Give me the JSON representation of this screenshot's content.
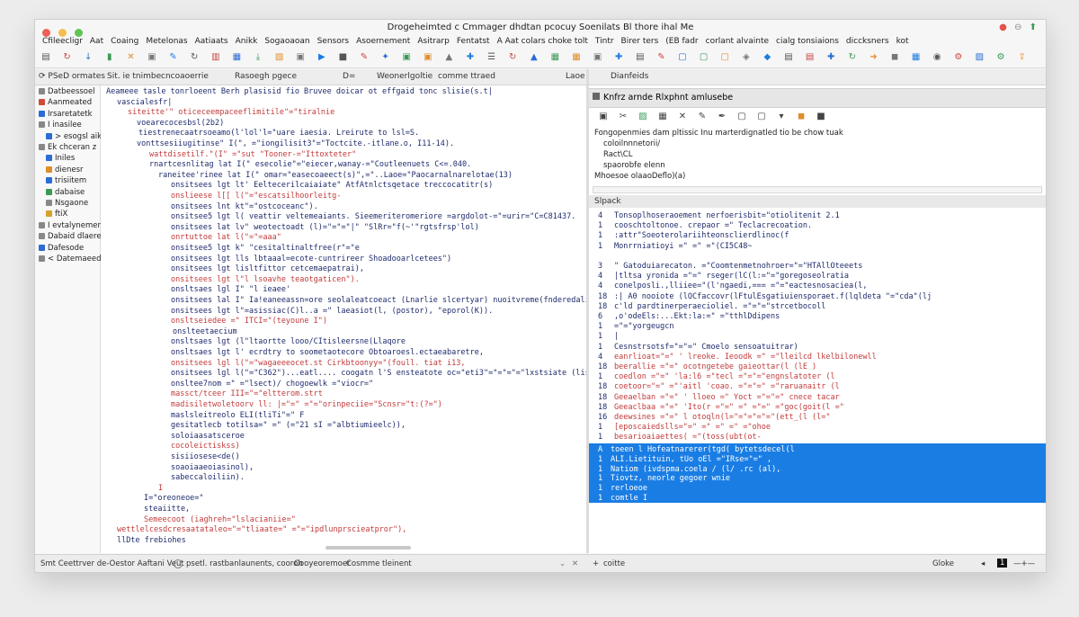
{
  "window": {
    "title": "Drogeheimted c Cmmager dhdtan pcocuy Soenilats Bl thore ihal Me",
    "controls_right": [
      "●",
      "⊖",
      "⬆"
    ]
  },
  "colors": {
    "close": "#ee5f57",
    "minimize": "#f5bd4f",
    "maximize": "#5fc453",
    "accent_blue": "#1a7de4",
    "string_red": "#c23a3a",
    "code_navy": "#1f2b6c"
  },
  "menu": [
    "Cfileecligr",
    "Aat",
    "Coaing",
    "Metelonas",
    "Aatiaats",
    "Anikk",
    "Sogaoaoan",
    "Sensors",
    "Asoernement",
    "Asitrarp",
    "Fentatst",
    "A Aat colars choke tolt",
    "Tintr",
    "Birer ters",
    "(EB fadr",
    "corlant alvainte",
    "cialg tonsiaions",
    "diccksners",
    "kot"
  ],
  "toolbar_icons": [
    "document-icon",
    "refresh-icon",
    "down-arrow-icon",
    "bookmark-icon",
    "close-x-icon",
    "window-icon",
    "paint-icon",
    "refresh-icon",
    "panel-icon",
    "grid-icon",
    "download-icon",
    "layout-icon",
    "window-icon",
    "play-icon",
    "square-icon",
    "edit-icon",
    "star-icon",
    "window-icon",
    "window-icon",
    "lock-icon",
    "pin-icon",
    "list-icon",
    "refresh-icon",
    "lock-icon",
    "grid-icon",
    "grid-icon",
    "window-icon",
    "pin-icon",
    "document-icon",
    "edit-icon",
    "frame-icon",
    "frame-icon",
    "frame-icon",
    "palette-icon",
    "shapes-icon",
    "doc-icon",
    "doc-icon",
    "pin-icon",
    "refresh-icon",
    "arrow-icon",
    "stop-icon",
    "grid-icon",
    "shield-icon",
    "gear-icon",
    "chart-icon",
    "settings-icon",
    "share-icon"
  ],
  "tabs": {
    "left": [
      "⟳ PSeD ormates",
      "Sit. ie tnimbe",
      "cncoaoerrie",
      "Rasoegh pgece",
      "D=",
      "Weonerlgoltie",
      "comme ttraed",
      "Laoe"
    ],
    "right": "Dianfeids"
  },
  "sidebar": [
    {
      "label": "Datbeessoel",
      "color": "#888888"
    },
    {
      "label": "Aanmeated",
      "color": "#d04a3b"
    },
    {
      "label": "Irsaretatetk",
      "color": "#2b6dd4"
    },
    {
      "label": "I inasilee",
      "color": "#888888"
    },
    {
      "label": "> esogsl aik",
      "color": "#2b6dd4"
    },
    {
      "label": "Ek chceran z",
      "color": "#888888"
    },
    {
      "label": "Iniles",
      "color": "#2b6dd4"
    },
    {
      "label": "dienesr",
      "color": "#e08d2c"
    },
    {
      "label": "trisiitem",
      "color": "#2b6dd4"
    },
    {
      "label": "dabaise",
      "color": "#3a9a55"
    },
    {
      "label": "Nsgaone",
      "color": "#888888"
    },
    {
      "label": "ftiX",
      "color": "#d6a32a"
    },
    {
      "label": "I evtalynements",
      "color": "#888888"
    },
    {
      "label": "Dabaid dlaere",
      "color": "#888888"
    },
    {
      "label": "Dafesode",
      "color": "#2b6dd4"
    },
    {
      "label": "< Datemaeed",
      "color": "#888888"
    }
  ],
  "editor": {
    "lines": [
      {
        "n": "",
        "t": "Aeameee tasle tonrloeent Berh plasisid fio Bruvee doicar ot effgaid tonc slisie(s.t|"
      },
      {
        "n": "",
        "t": "vascialesfr|"
      },
      {
        "n": "",
        "t": "siteitte'\" oticeceempaceeflimitile\"=\"tiralnie"
      },
      {
        "n": "",
        "t": "voearecocesbsl(2b2)"
      },
      {
        "n": "",
        "t": "tiestrenecaatrsoeamo(l'lol'l=\"uare iaesia. Lreirute to lsl=S."
      },
      {
        "n": "",
        "t": "vonttsesiiugitinse\"  I(\", =\"iongilisit3\"=\"Toctcite.-itlane.o,  I11-14)."
      },
      {
        "n": "",
        "t": "wattdisetilf.\"(I\" =\"sut \"Tooner-=\"Ittoxteter\""
      },
      {
        "n": "",
        "t": "rnartcesnlitag  lat  I(\" esecolie\"=\"eiecer,wanay-=\"Coutleenuets  C<=.040."
      },
      {
        "n": "",
        "t": "raneitee'rinee  lat  I(\" omar=\"easecoaeect(s)\",=\"..Laoe=\"Paocarnalnarelotae(13)"
      },
      {
        "n": "",
        "t": "onsitsees  lgt  lt' Eeltecerilcaiaiate\"   AtfAtnlctsqetace treccocatitr(s)"
      },
      {
        "n": "",
        "t": "onslieese  l[[  l(\"=\"escatsilhoorleitg-"
      },
      {
        "n": "",
        "t": "onsitsees  lnt  kt\"=\"ostcoceanc\")."
      },
      {
        "n": "",
        "t": "onsitsee5  lgt  l(  veattir  veltemeaiants.  Sieemeriteromeriore  =argdolot-=\"=urir=\"C=C81437."
      },
      {
        "n": "",
        "t": "onsitsees  lat  lv\"  weotectoadt (l)=\"=\"=\"|\" \"SlRr=\"f(~'\"rgtsfrsp'lol)"
      },
      {
        "n": "",
        "t": "onrtuttoe  lat  l(\"=\"=aaa\""
      },
      {
        "n": "",
        "t": "onsitsee5  lgt  k\"  \"cesitaltinaltfree(r\"=\"e"
      },
      {
        "n": "",
        "t": "onsitsees  lgt  lls  lbtaaal=ecote-cuntrireer  Shoadooarlcetees\")"
      },
      {
        "n": "",
        "t": "onsitsees  lgt  lisltfittor   cetcemaepatrai),"
      },
      {
        "n": "",
        "t": "onsitsees  lgt  l\"l  lsoavhe teaotgaticen\")."
      },
      {
        "n": "",
        "t": "onsltsaes  lgl  I\"  \"l ieaee'"
      },
      {
        "n": "",
        "t": "onsitsees  lal  I\"  Ia!eaneeassn=ore  seolaleatcoeact  (Lnarlie  slcertyar)  nuoitvreme(fnderedali,"
      },
      {
        "n": "",
        "t": "onsitsees  lgt  l\"=asissiac(C)l..a  =\"  laeasiot(l,  (postor),  \"eporol(K))."
      },
      {
        "n": "",
        "t": "onsltseiedee  =\"  ITCI=\"(teyoune  I\")"
      },
      {
        "n": "",
        "t": "onslteetaecium"
      },
      {
        "n": "",
        "t": "onsltsaes  lgt  (l\"ltaortte  looo/CItisleersne(Llaqore"
      },
      {
        "n": "",
        "t": "onsltsaes  lgt  l'  ecrdtry  to  soometaotecore  Obtoaroesl.ectaeabaretre,"
      },
      {
        "n": "",
        "t": "onsitsees  lgl  l(\"=\"wagaeeeocet.st  Cirkbtoonyy=\"(foull.  tiat  i13,"
      },
      {
        "n": "",
        "t": "onsitsees  lgl  l(\"=\"C362\")...eatl....  coogatn  l'S  ensteatote  oc=\"eti3\"=\"=\"=\"=\"lxstsiate  (lisocoete  (j"
      },
      {
        "n": "",
        "t": "onsltee7nom  =\"  =\"lsect)/  chogoewlk  =\"viocr=\""
      },
      {
        "n": "",
        "t": "massct/tceer  III=\"=\"eltterom.strt"
      },
      {
        "n": "",
        "t": "madisiletwoletoorv   ll:  |=\"=\"  =\"=\"orinpeciie=\"Scnsr=\"t:(?=\")"
      },
      {
        "n": "",
        "t": "maslsleitreolo  ELI(tliTi\"=\"  F"
      },
      {
        "n": "",
        "t": "gesitatlecb  totilsa=\"  =\"  (=\"21  sI  =\"albtiumieelc)),"
      },
      {
        "n": "",
        "t": "soloiaasatsceroe"
      },
      {
        "n": "",
        "t": "cocoleictiskss)"
      },
      {
        "n": "",
        "t": "sisiiosese<de()"
      },
      {
        "n": "",
        "t": "soaoiaaeoiasinol),"
      },
      {
        "n": "",
        "t": "sabeccaloiliin)."
      },
      {
        "n": "",
        "t": "I"
      },
      {
        "n": "I",
        "t": "=\"oreoneoe=\""
      },
      {
        "n": "",
        "t": "steaiitte,"
      },
      {
        "n": "",
        "t": "Semeecoot  (iaghreh=\"lslacianiie=\""
      },
      {
        "n": "",
        "t": "wettlelcesdcresaatataleo=\"=\"tliaate=\"  =\"=\"ipdlunprscieatpror\"),"
      },
      {
        "n": "",
        "t": "llDte      frebiohes"
      }
    ]
  },
  "right_panel": {
    "header": "Knfrz arnde Rlxphnt amlusebe",
    "toolbar_icons": [
      "save-icon",
      "cut-icon",
      "chart-icon",
      "grid-icon",
      "close-x-icon",
      "brush-icon",
      "pen-icon",
      "frame-icon",
      "frame-icon",
      "dropdown-icon",
      "stop-icon",
      "square-icon"
    ],
    "messages": [
      "Fongopenmies dam pltissic Inu marterdignatled tio be chow tuak",
      "coloilnnnetorii/",
      "Ract\\CL",
      "spaorobfe elenn",
      "Mhoesoe olaaoDeflo)(a)"
    ],
    "section_label": "Slpack",
    "output_lines": [
      {
        "n": "4",
        "t": "Tonsoplhoseraoement  nerfoerisbit=\"otiolitenit  2.1"
      },
      {
        "n": "1",
        "t": "cooschtoltonoe.  crepaor  =\"  Teclacrecoation."
      },
      {
        "n": "1",
        "t": "  :attr\"Soeoterolariihteonsclierdlinoc(f"
      },
      {
        "n": "1",
        "t": "    Monrrniatioyi  =\"  =\"  =\"(CI5C48~"
      },
      {
        "n": "",
        "t": ""
      },
      {
        "n": "3",
        "t": "    \"   Gatoduiarecaton.  =\"Coomtenmetnohroer=\"=\"HTAllOteeets"
      },
      {
        "n": "4",
        "t": "    |tltsa  yronida  =\"=\"  rseger(lC(l:=\"=\"goregoseolratia"
      },
      {
        "n": "4",
        "t": "       conelposli.,lliiee=\"(l'ngaedi,===  =\"=\"eactesnosaciea(l,"
      },
      {
        "n": "18",
        "t": "         :|  A0  nooiote  (lOCfaccovr(lFtulEsgatiuiensporaet.f(lqldeta  \"=\"cda\"(lj"
      },
      {
        "n": "18",
        "t": "     c'ld  pardtinerperaecioliel.  =\"=\"=\"strcetbocoll"
      },
      {
        "n": "6",
        "t": "           ,o'odeEls:...Ekt:la:=\"  =\"tthlDdipens"
      },
      {
        "n": "1",
        "t": "               =\"=\"yorgeugcn"
      },
      {
        "n": "1",
        "t": "              |"
      },
      {
        "n": "1",
        "t": "                  Cesnstrsotsf=\"=\"=\"  Cmoelo  sensoatuitrar)"
      },
      {
        "n": "4",
        "t": "                    eanrlioat=\"=\"  '  lreoke.  Ieoodk  =\"  =\"lleilcd  lkelbilonewll"
      },
      {
        "n": "18",
        "t": "                    beerallie  =\"=\"  ocotngetebe  gaieottar(l  (lE  )"
      },
      {
        "n": "1",
        "t": "                    coedlon  =\"=\"  'la:l6  =\"tecl  =\"=\"=\"engnslatoter  (l"
      },
      {
        "n": "18",
        "t": "                    coetoor=\"=\"  =\"'aitl  'coao.  =\"=\"=\"  =\"raruanaitr  (l"
      },
      {
        "n": "18",
        "t": "                    Geeaelban  =\"=\"  '  lloeo  =\"  Yoct  =\"=\"=\"  cnece  tacar"
      },
      {
        "n": "18",
        "t": "                    Geeaclbaa  =\"=\"  'Ito(r  =\"=\"  =\"  =\"=\"  =\"goc(goit(l  =\""
      },
      {
        "n": "16",
        "t": "                    deewsines  =\"=\"  l  otoqln(l=\"=\"=\"=\"=\"(ett_(l  (l=\""
      },
      {
        "n": "1",
        "t": "                  [eposcaiedslls=\"=\"  =\"  =\"  =\"  =\"ohoe"
      },
      {
        "n": "1",
        "t": "                    besarioaiaettes(  =\"(toss(ubt(ot-"
      }
    ],
    "highlighted_lines": [
      {
        "n": "A",
        "t": "  toeen    l  Hofeatnarerer(tgd(  bytetsdecel(l"
      },
      {
        "n": "1",
        "t": "  ALI.Lietituin,  tUo  oEl  =\"IRse=\"=\"  ,"
      },
      {
        "n": "1",
        "t": "  Natiom  (ivdspma.coela  /  (l/  .rc  (al),"
      },
      {
        "n": "1",
        "t": "  Tiovtz,  neorle  gegoer  wnie"
      },
      {
        "n": "1",
        "t": "  rerloeoe"
      },
      {
        "n": "1",
        "t": "  comtle  I"
      }
    ]
  },
  "status": {
    "left": "Smt Ceettrver de-Oestor Aaftani Veut",
    "middle": "psetl. rastbanlaunents, cooroh",
    "compose": "Cooyeoremoer",
    "theme": "Cosmme tleinent",
    "right_label": "coitte",
    "zoom": "Gloke",
    "indicator": "1",
    "line_mark": "—+—"
  }
}
